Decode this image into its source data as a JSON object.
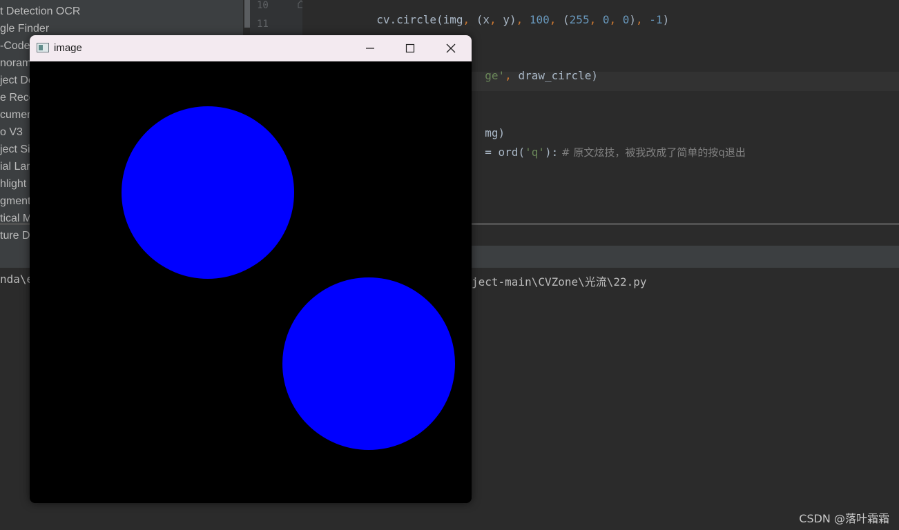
{
  "project_tree": {
    "items": [
      {
        "label": "t Detection OCR"
      },
      {
        "label": "gle Finder"
      },
      {
        "label": "-Code"
      },
      {
        "label": "norama"
      },
      {
        "label": "ject De"
      },
      {
        "label": "e Reco"
      },
      {
        "label": "cumen"
      },
      {
        "label": "o V3"
      },
      {
        "label": "ject Si"
      },
      {
        "label": "ial Lan"
      },
      {
        "label": "hlight"
      },
      {
        "label": "gment"
      },
      {
        "label": "tical M"
      },
      {
        "label": "ture D"
      }
    ]
  },
  "gutter": {
    "line_numbers": [
      "10",
      "11"
    ]
  },
  "editor": {
    "line10": {
      "fn": "cv.circle(img",
      "c1": ",",
      "t1": " (x",
      "c2": ",",
      "t2": " y)",
      "c3": ",",
      "n1": " 100",
      "c4": ",",
      "t3": " (",
      "n2": "255",
      "c5": ",",
      "n3": " 0",
      "c6": ",",
      "n4": " 0",
      "t4": ")",
      "c7": ",",
      "n5": " -1",
      "t5": ")"
    },
    "line13": {
      "str": "ge'",
      "comma": ",",
      "rest": " draw_circle)"
    },
    "line16": {
      "text": "mg)"
    },
    "line17": {
      "op": "=",
      "fn": " ord(",
      "str": "'q'",
      "rest": "):",
      "comment": " # 原文炫技，被我改成了简单的按q退出"
    }
  },
  "console": {
    "left_text": "nda\\e",
    "path_text": "ject-main\\CVZone\\光流\\22.py"
  },
  "watermark": "CSDN @落叶霜霜",
  "image_window": {
    "title": "image",
    "circle_color": "#0000ff",
    "background": "#000000"
  }
}
